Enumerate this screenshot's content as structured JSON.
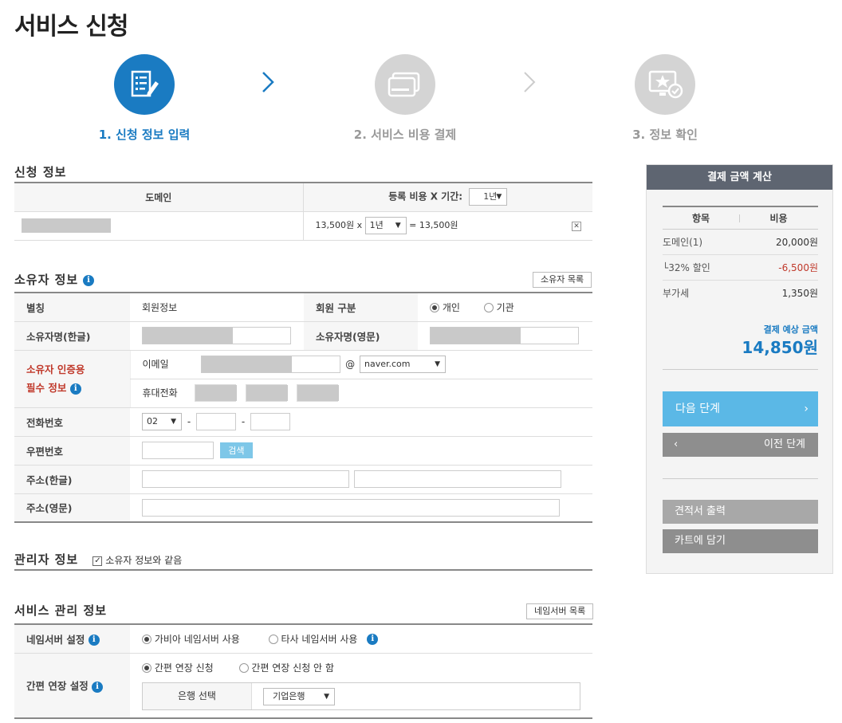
{
  "page": {
    "title": "서비스 신청"
  },
  "steps": [
    {
      "label": "1. 신청 정보 입력"
    },
    {
      "label": "2. 서비스 비용 결제"
    },
    {
      "label": "3. 정보 확인"
    }
  ],
  "apply": {
    "title": "신청 정보",
    "col_domain": "도메인",
    "col_period": "등록 비용 X 기간:",
    "period_value": "1년",
    "row_price": "13,500원 x",
    "row_period": "1년",
    "row_total": "= 13,500원",
    "remove": "✕"
  },
  "owner": {
    "title": "소유자 정보",
    "list_button": "소유자 목록",
    "alias_label": "별칭",
    "alias_value": "회원정보",
    "member_type_label": "회원 구분",
    "type_personal": "개인",
    "type_org": "기관",
    "name_kr_label": "소유자명(한글)",
    "name_en_label": "소유자명(영문)",
    "auth_label_1": "소유자 인증용",
    "auth_label_2": "필수 정보",
    "email_label": "이메일",
    "at": "@",
    "email_domain": "naver.com",
    "mobile_label": "휴대전화",
    "phone_label": "전화번호",
    "phone_prefix": "02",
    "dash": "-",
    "zip_label": "우편번호",
    "zip_search": "검색",
    "addr_kr_label": "주소(한글)",
    "addr_en_label": "주소(영문)"
  },
  "admin": {
    "title": "관리자 정보",
    "same_label": "소유자 정보와 같음"
  },
  "service": {
    "title": "서비스 관리 정보",
    "ns_list_button": "네임서버 목록",
    "ns_label": "네임서버 설정",
    "ns_opt1": "가비아 네임서버 사용",
    "ns_opt2": "타사 네임서버 사용",
    "renew_label": "간편 연장 설정",
    "renew_opt1": "간편 연장 신청",
    "renew_opt2": "간편 연장 신청 안 함",
    "bank_label": "은행 선택",
    "bank_value": "기업은행"
  },
  "calc": {
    "title": "결제 금액 계산",
    "col_item": "항목",
    "col_cost": "비용",
    "rows": [
      {
        "item": "도메인(1)",
        "cost": "20,000원"
      },
      {
        "item": "└32% 할인",
        "cost": "-6,500원"
      },
      {
        "item": "부가세",
        "cost": "1,350원"
      }
    ],
    "expected_label": "결제 예상 금액",
    "expected_amount": "14,850원",
    "next_button": "다음 단계",
    "prev_button": "이전 단계",
    "quote_button": "견적서 출력",
    "cart_button": "카트에 담기"
  },
  "colors": {
    "accent": "#1a7bc2",
    "discount": "#c0392b",
    "next_btn": "#5bb8e6",
    "gray_btn": "#8e8e8e"
  }
}
